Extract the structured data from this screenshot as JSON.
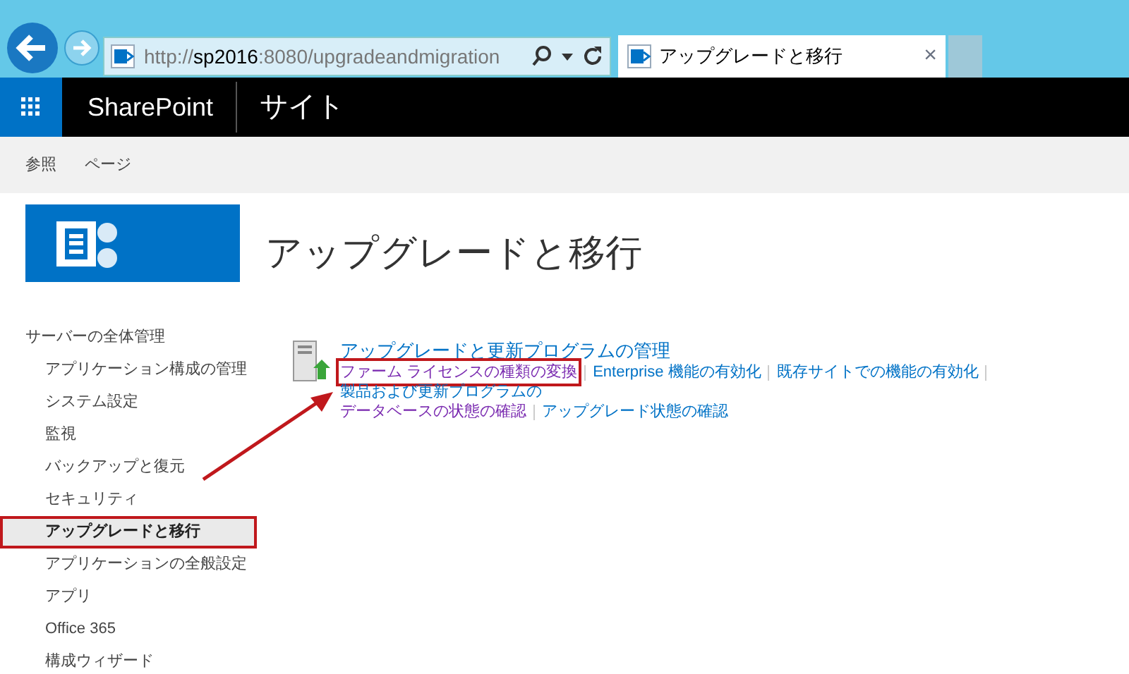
{
  "browser": {
    "address": [
      {
        "kind": "dim",
        "text": "http://"
      },
      {
        "kind": "host",
        "text": "sp2016"
      },
      {
        "kind": "dim",
        "text": ":8080/upgradeandmigration"
      }
    ],
    "tab": {
      "title": "アップグレードと移行",
      "close": "×"
    }
  },
  "suite_bar": {
    "app": "SharePoint",
    "site": "サイト"
  },
  "ribbon": {
    "tabs": [
      "参照",
      "ページ"
    ]
  },
  "page_title": "アップグレードと移行",
  "quick_launch": {
    "heading": "サーバーの全体管理",
    "items": [
      {
        "label": "アプリケーション構成の管理",
        "selected": false,
        "highlighted": false
      },
      {
        "label": "システム設定",
        "selected": false,
        "highlighted": false
      },
      {
        "label": "監視",
        "selected": false,
        "highlighted": false
      },
      {
        "label": "バックアップと復元",
        "selected": false,
        "highlighted": false
      },
      {
        "label": "セキュリティ",
        "selected": false,
        "highlighted": false
      },
      {
        "label": "アップグレードと移行",
        "selected": true,
        "highlighted": true
      },
      {
        "label": "アプリケーションの全般設定",
        "selected": false,
        "highlighted": false
      },
      {
        "label": "アプリ",
        "selected": false,
        "highlighted": false
      },
      {
        "label": "Office 365",
        "selected": false,
        "highlighted": false
      },
      {
        "label": "構成ウィザード",
        "selected": false,
        "highlighted": false
      }
    ]
  },
  "section": {
    "heading": "アップグレードと更新プログラムの管理",
    "links": [
      {
        "label": "ファーム ライセンスの種類の変換",
        "visited": true,
        "highlighted": true
      },
      {
        "label": "Enterprise 機能の有効化",
        "visited": false,
        "highlighted": false
      },
      {
        "label": "既存サイトでの機能の有効化",
        "visited": false,
        "highlighted": false
      },
      {
        "label": "製品および更新プログラムの",
        "visited": false,
        "highlighted": false
      },
      {
        "label": "データベースの状態の確認",
        "visited": true,
        "highlighted": false
      },
      {
        "label": "アップグレード状態の確認",
        "visited": false,
        "highlighted": false
      }
    ]
  }
}
